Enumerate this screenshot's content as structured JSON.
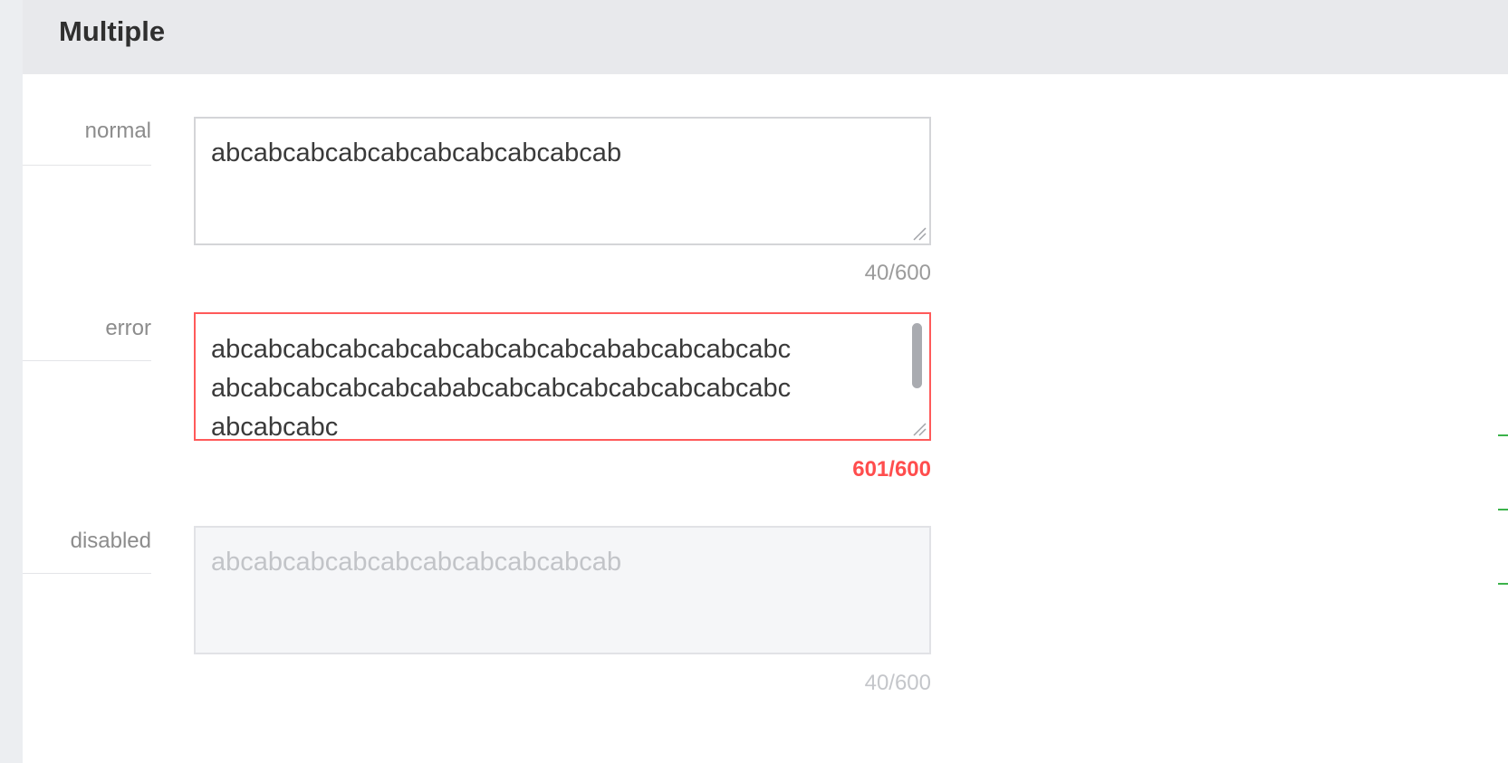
{
  "section": {
    "title": "Multiple"
  },
  "fields": {
    "normal": {
      "label": "normal",
      "lines": [
        "abcabcabcabcabcabcabcabcabcab"
      ],
      "counter": "40/600"
    },
    "error": {
      "label": "error",
      "lines": [
        "abcabcabcabcabcabcabcabcabcababcabcabcabc",
        "abcabcabcabcabcababcabcabcabcabcabcabcabc",
        "abcabcabc"
      ],
      "counter": "601/600"
    },
    "disabled": {
      "label": "disabled",
      "lines": [
        "abcabcabcabcabcabcabcabcabcab"
      ],
      "counter": "40/600"
    }
  },
  "colors": {
    "error_border": "#ff5a5a",
    "error_counter": "#ff4d4d",
    "header_bg": "#e8e9ec",
    "disabled_bg": "#f5f6f8"
  }
}
